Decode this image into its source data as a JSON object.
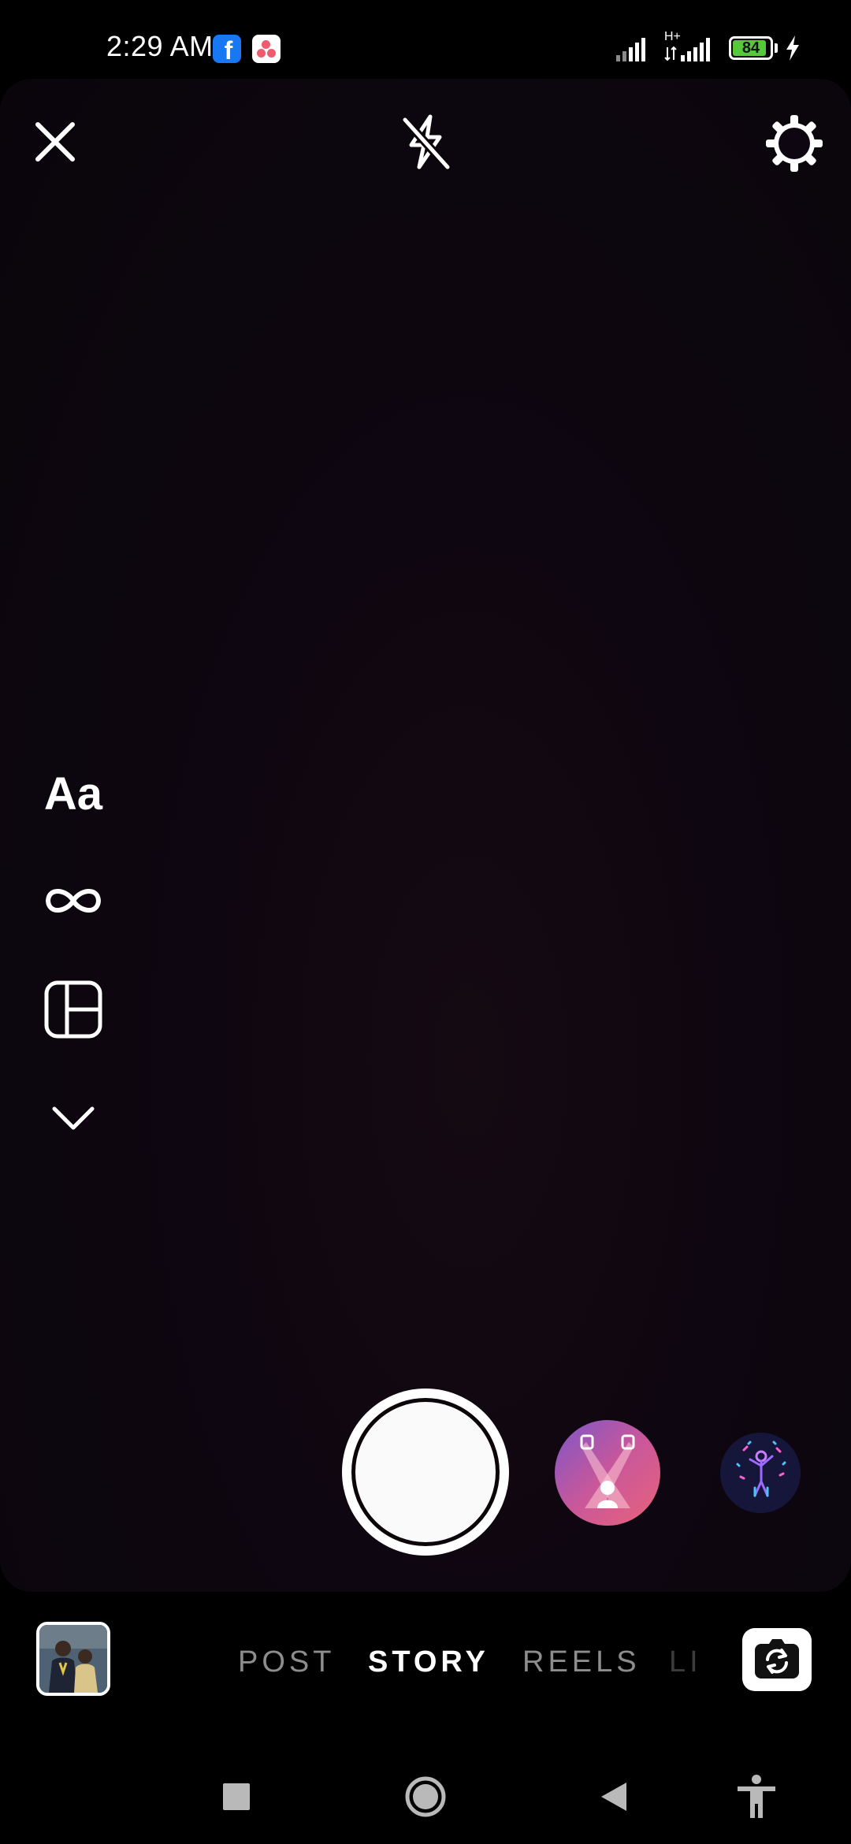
{
  "status_bar": {
    "time": "2:29 AM",
    "network_type": "H+",
    "battery_level": "84",
    "battery_fraction": 0.84,
    "notification_icons": [
      "facebook-icon",
      "app-notification-icon"
    ]
  },
  "camera": {
    "top_controls": [
      "close-icon",
      "flash-off-icon",
      "settings-icon"
    ],
    "side_tools": {
      "text_tool_label": "Aa",
      "icons": [
        "text-create-mode",
        "boomerang-icon",
        "layout-icon",
        "chevron-down-icon"
      ]
    },
    "shutter": "shutter-button",
    "effects": [
      "spotlight-effect",
      "dancing-figure-effect"
    ]
  },
  "mode_bar": {
    "modes": [
      "POST",
      "STORY",
      "REELS",
      "LIVE"
    ],
    "visible_modes": {
      "post": "POST",
      "story": "STORY",
      "reels": "REELS",
      "live_partial": "LI"
    },
    "active_mode": "STORY"
  },
  "nav_bar": {
    "buttons": [
      "recents-icon",
      "home-icon",
      "back-icon",
      "accessibility-icon"
    ]
  },
  "colors": {
    "background": "#000000",
    "viewfinder": "#0e0610",
    "battery_fill": "#55c93a",
    "facebook_blue": "#1877f2",
    "inactive_mode": "#8d8d8d"
  }
}
